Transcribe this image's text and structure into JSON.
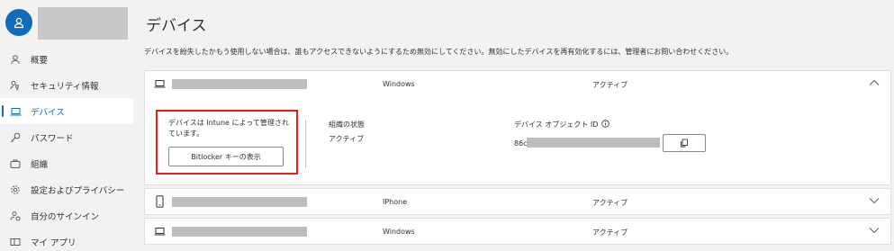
{
  "sidebar": {
    "items": [
      {
        "label": "概要",
        "icon": "person-icon",
        "active": false
      },
      {
        "label": "セキュリティ情報",
        "icon": "key-person-icon",
        "active": false
      },
      {
        "label": "デバイス",
        "icon": "laptop-icon",
        "active": true
      },
      {
        "label": "パスワード",
        "icon": "key-icon",
        "active": false
      },
      {
        "label": "組織",
        "icon": "briefcase-icon",
        "active": false
      },
      {
        "label": "設定およびプライバシー",
        "icon": "gear-icon",
        "active": false
      },
      {
        "label": "自分のサインイン",
        "icon": "person-signin-icon",
        "active": false
      },
      {
        "label": "マイ アプリ",
        "icon": "apps-icon",
        "active": false
      }
    ]
  },
  "main": {
    "title": "デバイス",
    "description": "デバイスを紛失したかもう使用しない場合は、誰もアクセスできないようにするため無効にしてください。無効にしたデバイスを再有効化するには、管理者にお問い合わせください。",
    "devices": [
      {
        "os": "Windows",
        "status": "アクティブ",
        "expanded": true,
        "managed_text": "デバイスは Intune によって管理されています。",
        "bitlocker_button": "Bitlocker キーの表示",
        "org_state_label": "組織の状態",
        "org_state_value": "アクティブ",
        "object_id_label": "デバイス オブジェクト ID",
        "object_id_prefix": "86c"
      },
      {
        "os": "IPhone",
        "status": "アクティブ",
        "expanded": false
      },
      {
        "os": "Windows",
        "status": "アクティブ",
        "expanded": false
      }
    ]
  },
  "colors": {
    "accent": "#0f6cbd",
    "highlight": "#e0201b",
    "background": "#f3f2f1"
  }
}
